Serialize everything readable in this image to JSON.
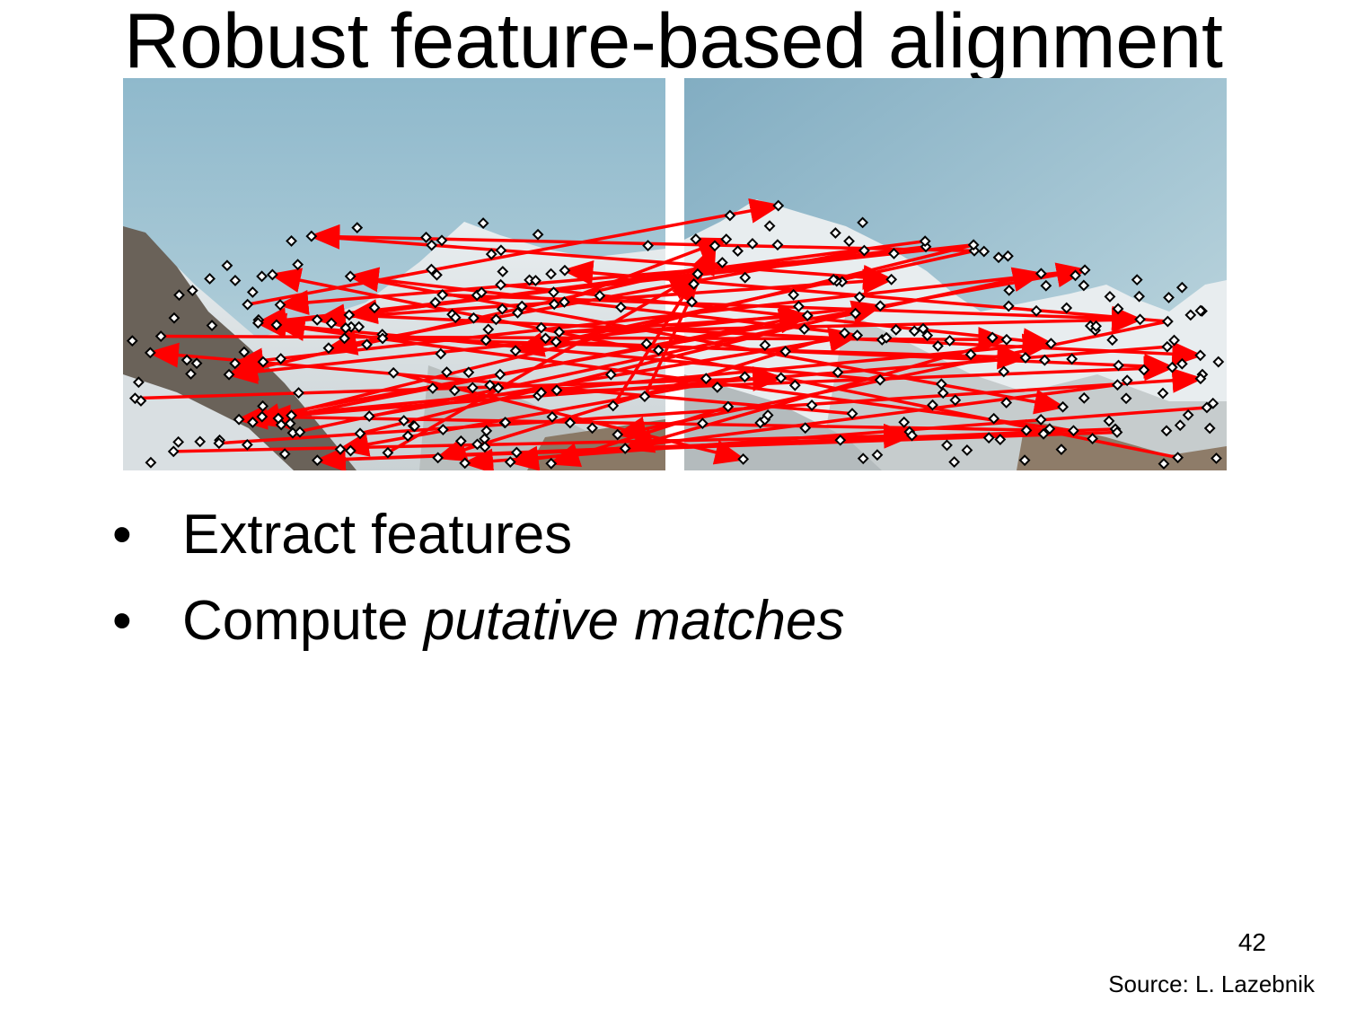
{
  "slide": {
    "title": "Robust feature-based alignment",
    "bullets": [
      {
        "text": "Extract features",
        "emphasis": ""
      },
      {
        "text": "Compute ",
        "emphasis": "putative matches"
      }
    ],
    "bullet_glyph": "•",
    "page_number": "42",
    "source": "Source: L. Lazebnik"
  },
  "figure": {
    "description_colors": {
      "sky": "#86b1c6",
      "match_line": "#ff0000",
      "keypoint_fill": "#ffffff"
    }
  }
}
